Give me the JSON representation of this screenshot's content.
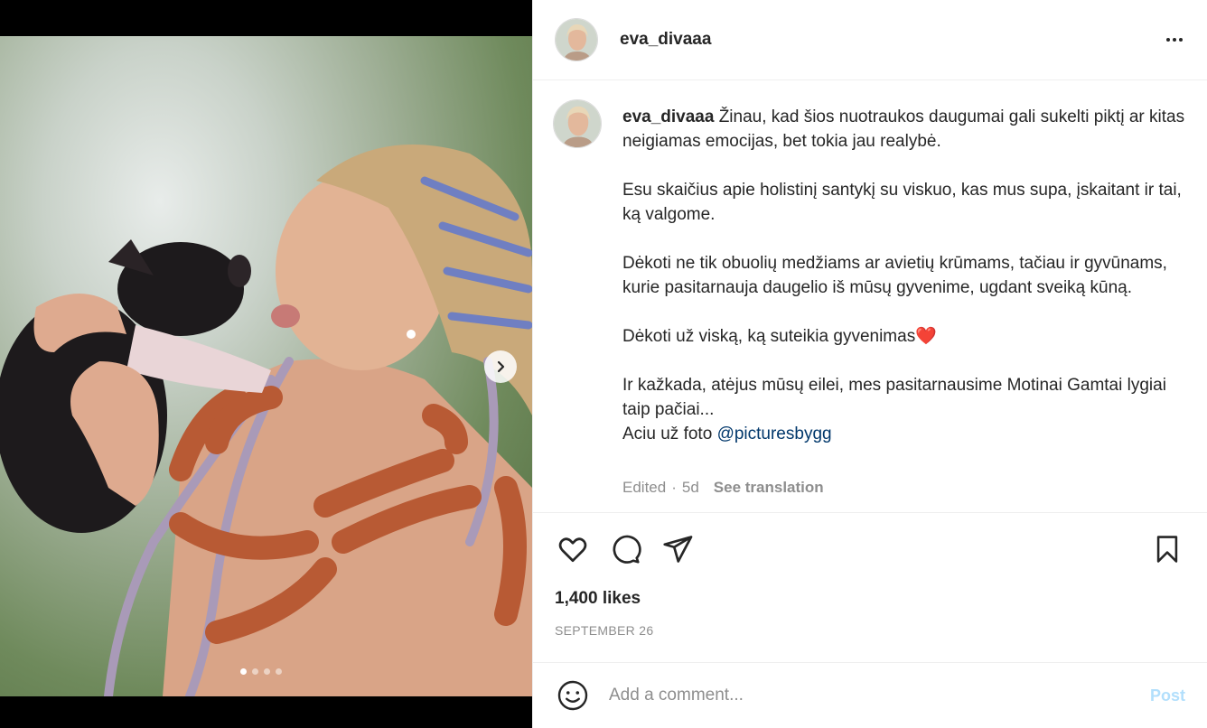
{
  "post": {
    "username": "eva_divaaa",
    "caption": {
      "lines": [
        "Žinau, kad šios nuotraukos daugumai gali sukelti piktį ar kitas neigiamas emocijas, bet tokia jau realybė.",
        "Esu skaičius apie holistinį santykį su viskuo, kas mus supa, įskaitant ir tai, ką valgome.",
        "Dėkoti ne tik obuolių medžiams ar avietių krūmams, tačiau ir gyvūnams, kurie pasitarnauja daugelio iš mūsų gyvenime, ugdant sveiką kūną.",
        "Dėkoti už viską, ką suteikia gyvenimas",
        "Ir kažkada, atėjus mūsų eilei, mes pasitarnausime Motinai Gamtai lygiai taip pačiai...",
        "Aciu už foto"
      ],
      "heart": "❤️",
      "mention": "@picturesbygg"
    },
    "edited": "Edited",
    "separator": "·",
    "age": "5d",
    "see_translation": "See translation",
    "likes": "1,400 likes",
    "date": "SEPTEMBER 26"
  },
  "media": {
    "carousel_count": 4,
    "active_index": 0
  },
  "comment": {
    "placeholder": "Add a comment...",
    "post_label": "Post"
  },
  "icons": {
    "more": "more-options-icon",
    "like": "heart-icon",
    "comment": "comment-bubble-icon",
    "share": "paper-plane-icon",
    "save": "bookmark-icon",
    "emoji": "smiley-icon",
    "next": "chevron-right-icon"
  },
  "colors": {
    "link": "#00376b",
    "muted": "#8e8e8e",
    "post_disabled": "#b2dffc",
    "heart": "#ed4956"
  }
}
